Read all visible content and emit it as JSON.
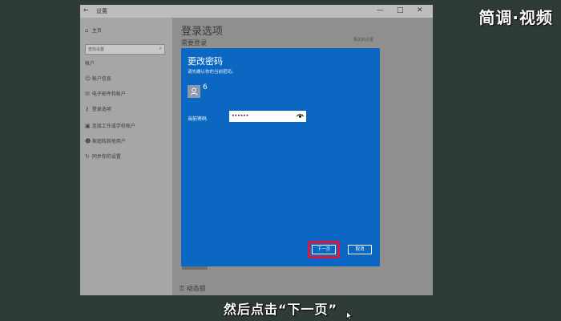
{
  "watermark": "简调·视频",
  "window": {
    "title": "设置",
    "controls": {
      "minimize": "—",
      "maximize": "□",
      "close": "✕"
    }
  },
  "sidebar": {
    "home": "主页",
    "search_placeholder": "查找设置",
    "section": "帐户",
    "items": [
      {
        "label": "帐户信息",
        "icon": "person-icon"
      },
      {
        "label": "电子邮件和帐户",
        "icon": "mail-icon"
      },
      {
        "label": "登录选项",
        "icon": "key-icon"
      },
      {
        "label": "连接工作或学校帐户",
        "icon": "briefcase-icon"
      },
      {
        "label": "家庭和其他用户",
        "icon": "people-icon"
      },
      {
        "label": "同步你的设置",
        "icon": "sync-icon"
      }
    ]
  },
  "main": {
    "title": "登录选项",
    "subtitle": "需要登录",
    "related": "相关的设置",
    "dynamic_lock": "动态锁"
  },
  "dialog": {
    "title": "更改密码",
    "subtitle": "请先确认你的当前密码。",
    "username": "6",
    "password_label": "当前密码",
    "password_value": "••••••",
    "next_button": "下一页",
    "cancel_button": "取消"
  },
  "caption": "然后点击“下一页”",
  "colors": {
    "dialog_blue": "#0b67c2",
    "highlight_red": "#e0143c",
    "background": "#2f3b36"
  }
}
